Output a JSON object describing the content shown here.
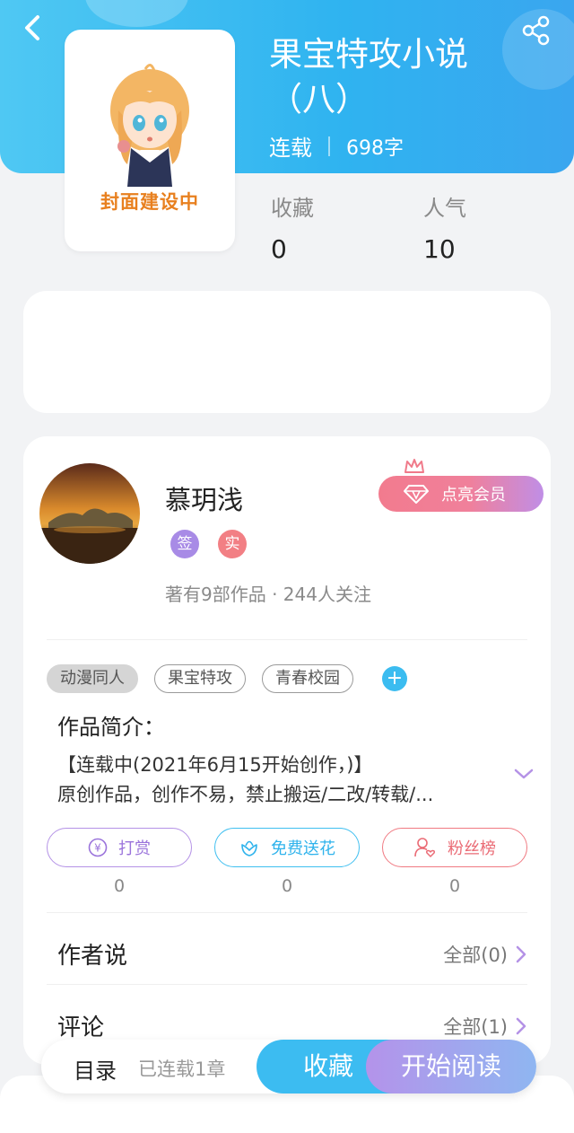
{
  "header": {
    "title_line1": "果宝特攻小说",
    "title_line2": "（八）",
    "status": "连载",
    "word_count": "698字",
    "accent_color": "#2fb3f0"
  },
  "cover": {
    "placeholder_text": "封面建设中"
  },
  "stats": [
    {
      "label": "收藏",
      "value": "0"
    },
    {
      "label": "人气",
      "value": "10"
    }
  ],
  "author": {
    "name": "慕玥浅",
    "badges": [
      "签",
      "实"
    ],
    "meta": "著有9部作品 · 244人关注",
    "vip_button": "点亮会员"
  },
  "tags": [
    "动漫同人",
    "果宝特攻",
    "青春校园"
  ],
  "intro": {
    "title": "作品简介：",
    "line1": "【连载中(2021年6月15开始创作，)】",
    "line2": "原创作品，创作不易，禁止搬运/二改/转载/..."
  },
  "actions": [
    {
      "label": "打赏",
      "count": "0"
    },
    {
      "label": "免费送花",
      "count": "0"
    },
    {
      "label": "粉丝榜",
      "count": "0"
    }
  ],
  "sections": {
    "author_says": {
      "title": "作者说",
      "link": "全部(0)"
    },
    "comments": {
      "title": "评论",
      "link": "全部(1)"
    }
  },
  "bottom_bar": {
    "toc_label": "目录",
    "toc_status": "已连载1章",
    "favorite": "收藏",
    "start_reading": "开始阅读"
  }
}
